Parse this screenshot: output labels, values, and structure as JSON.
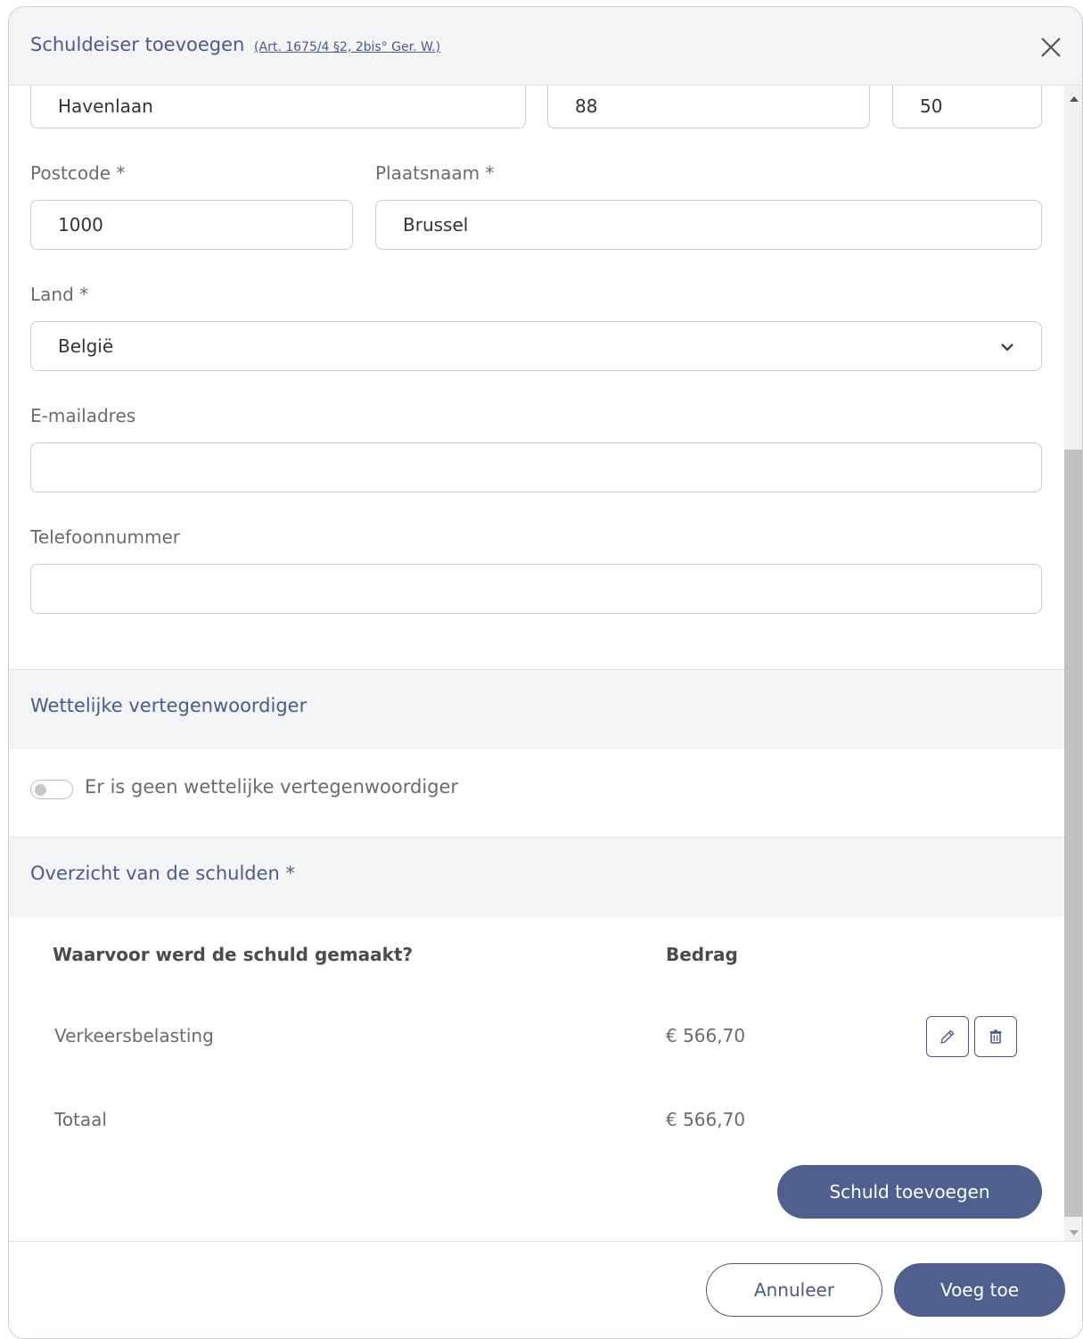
{
  "header": {
    "title": "Schuldeiser toevoegen",
    "legal_link": "(Art. 1675/4 §2, 2bis° Ger. W.)"
  },
  "address": {
    "street_value": "Havenlaan",
    "number_value": "88",
    "box_value": "50"
  },
  "postcode": {
    "label": "Postcode *",
    "value": "1000"
  },
  "city": {
    "label": "Plaatsnaam *",
    "value": "Brussel"
  },
  "country": {
    "label": "Land *",
    "value": "België"
  },
  "email": {
    "label": "E-mailadres",
    "value": ""
  },
  "phone": {
    "label": "Telefoonnummer",
    "value": ""
  },
  "legal_rep": {
    "title": "Wettelijke vertegenwoordiger",
    "toggle_label": "Er is geen wettelijke vertegenwoordiger"
  },
  "debts": {
    "title": "Overzicht van de schulden *",
    "col_reason": "Waarvoor werd de schuld gemaakt?",
    "col_amount": "Bedrag",
    "rows": [
      {
        "reason": "Verkeersbelasting",
        "amount": "€ 566,70"
      }
    ],
    "total_label": "Totaal",
    "total_amount": "€ 566,70",
    "add_button": "Schuld toevoegen"
  },
  "footer": {
    "cancel_label": "Annuleer",
    "submit_label": "Voeg toe"
  },
  "colors": {
    "accent": "#4f5f8f",
    "heading": "#4a5a8a",
    "section_bg": "#f3f4f6"
  }
}
